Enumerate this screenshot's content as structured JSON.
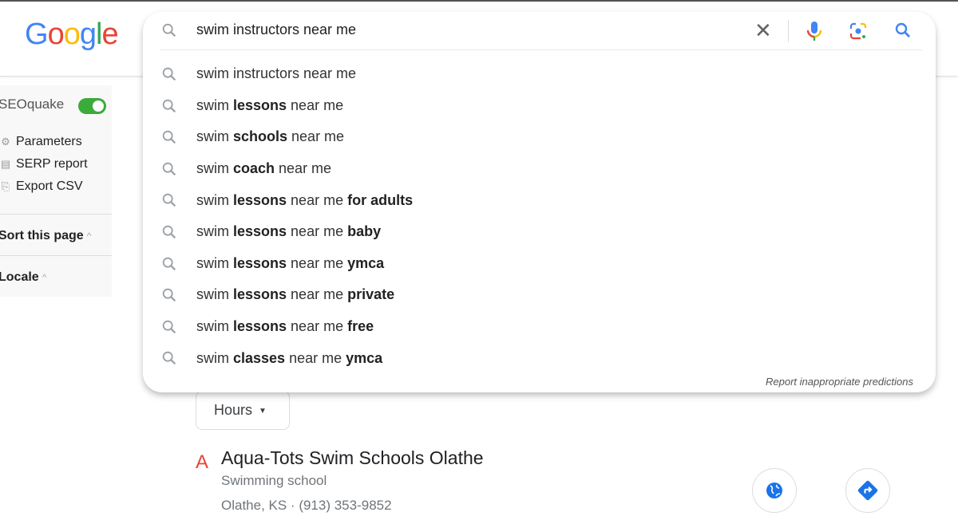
{
  "header": {
    "logo": "Google"
  },
  "search": {
    "query": "swim instructors near me",
    "suggestions": [
      [
        {
          "t": "swim instructors near me",
          "b": false
        }
      ],
      [
        {
          "t": "swim ",
          "b": false
        },
        {
          "t": "lessons",
          "b": true
        },
        {
          "t": " near me",
          "b": false
        }
      ],
      [
        {
          "t": "swim ",
          "b": false
        },
        {
          "t": "schools",
          "b": true
        },
        {
          "t": " near me",
          "b": false
        }
      ],
      [
        {
          "t": "swim ",
          "b": false
        },
        {
          "t": "coach",
          "b": true
        },
        {
          "t": " near me",
          "b": false
        }
      ],
      [
        {
          "t": "swim ",
          "b": false
        },
        {
          "t": "lessons",
          "b": true
        },
        {
          "t": " near me ",
          "b": false
        },
        {
          "t": "for adults",
          "b": true
        }
      ],
      [
        {
          "t": "swim ",
          "b": false
        },
        {
          "t": "lessons",
          "b": true
        },
        {
          "t": " near me ",
          "b": false
        },
        {
          "t": "baby",
          "b": true
        }
      ],
      [
        {
          "t": "swim ",
          "b": false
        },
        {
          "t": "lessons",
          "b": true
        },
        {
          "t": " near me ",
          "b": false
        },
        {
          "t": "ymca",
          "b": true
        }
      ],
      [
        {
          "t": "swim ",
          "b": false
        },
        {
          "t": "lessons",
          "b": true
        },
        {
          "t": " near me ",
          "b": false
        },
        {
          "t": "private",
          "b": true
        }
      ],
      [
        {
          "t": "swim ",
          "b": false
        },
        {
          "t": "lessons",
          "b": true
        },
        {
          "t": " near me ",
          "b": false
        },
        {
          "t": "free",
          "b": true
        }
      ],
      [
        {
          "t": "swim ",
          "b": false
        },
        {
          "t": "classes",
          "b": true
        },
        {
          "t": " near me ",
          "b": false
        },
        {
          "t": "ymca",
          "b": true
        }
      ]
    ],
    "report_link": "Report inappropriate predictions",
    "icons": [
      "search-icon",
      "clear-icon",
      "microphone-icon",
      "google-lens-icon"
    ]
  },
  "seoquake": {
    "title": "SEOquake",
    "enabled": true,
    "items": [
      {
        "label": "Parameters",
        "icon": "gear-icon"
      },
      {
        "label": "SERP report",
        "icon": "report-icon"
      },
      {
        "label": "Export CSV",
        "icon": "export-icon"
      }
    ],
    "sort_label": "Sort this page",
    "locale_label": "Locale"
  },
  "results": {
    "filter_hours": "Hours",
    "listing": {
      "marker": "A",
      "name": "Aqua-Tots Swim Schools Olathe",
      "category": "Swimming school",
      "address": "Olathe, KS · (913) 353-9852"
    }
  },
  "colors": {
    "accent": "#4285f4",
    "toggle": "#3bab3a",
    "marker": "#ea4335"
  }
}
